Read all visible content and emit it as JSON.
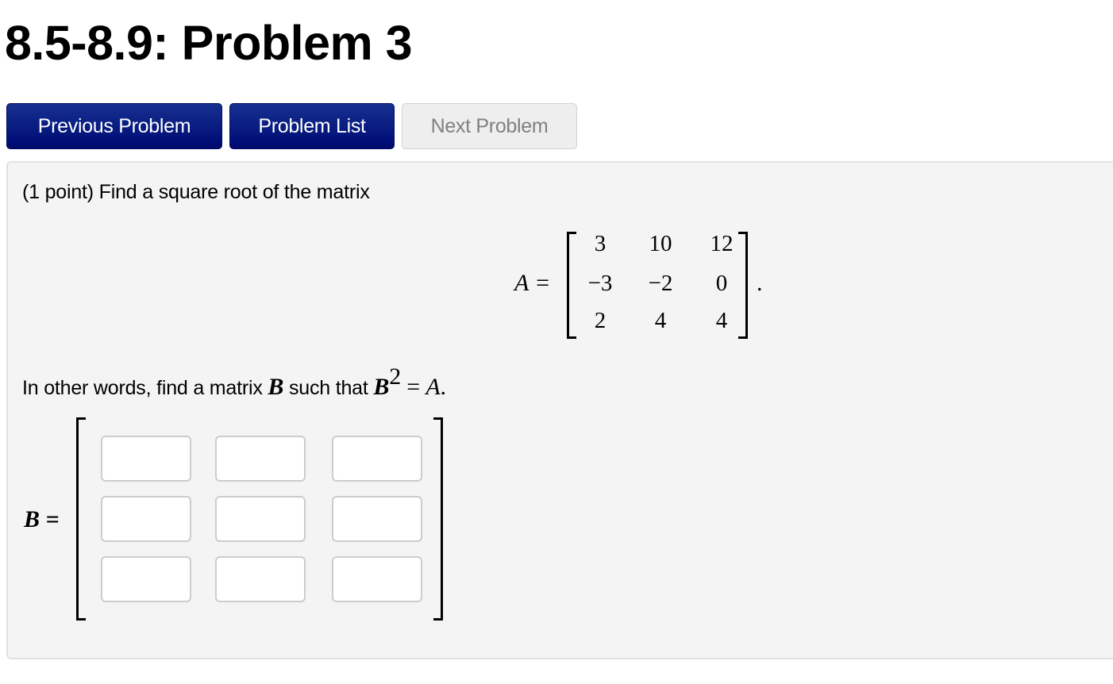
{
  "page": {
    "title": "8.5-8.9: Problem 3"
  },
  "nav": {
    "previous_label": "Previous Problem",
    "list_label": "Problem List",
    "next_label": "Next Problem",
    "next_disabled": true,
    "primary_color": "#000f78"
  },
  "problem": {
    "points": "(1 point)",
    "intro_text": "Find a square root of the matrix",
    "matrix_a": {
      "label": "A =",
      "rows": [
        [
          "3",
          "10",
          "12"
        ],
        [
          "−3",
          "−2",
          "0"
        ],
        [
          "2",
          "4",
          "4"
        ]
      ],
      "trailing": "."
    },
    "sentence": {
      "prefix": "In other words, find a matrix ",
      "var_b": "B",
      "middle": " such that ",
      "b_squared": "B",
      "exponent": "2",
      "equals": " = ",
      "var_a": "A",
      "end": "."
    },
    "answer_matrix": {
      "label": "B =",
      "values": [
        [
          "",
          "",
          ""
        ],
        [
          "",
          "",
          ""
        ],
        [
          "",
          "",
          ""
        ]
      ]
    }
  }
}
